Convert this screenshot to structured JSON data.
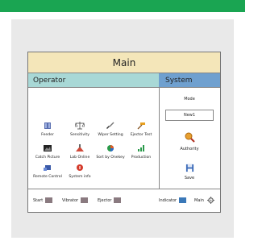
{
  "title": "Main",
  "sections": {
    "operator": "Operator",
    "system": "System"
  },
  "tools": [
    {
      "label": "Feeder",
      "icon": "feeder-icon"
    },
    {
      "label": "Sensitivity",
      "icon": "scale-icon"
    },
    {
      "label": "Wiper Setting",
      "icon": "brush-icon"
    },
    {
      "label": "Ejector Test",
      "icon": "hammer-icon"
    },
    {
      "label": "Catch Picture",
      "icon": "picture-icon"
    },
    {
      "label": "Lab Online",
      "icon": "flask-icon"
    },
    {
      "label": "Sort by Onekey",
      "icon": "sort-icon"
    },
    {
      "label": "Production",
      "icon": "chart-icon"
    },
    {
      "label": "Remote Control",
      "icon": "remote-icon"
    },
    {
      "label": "System info",
      "icon": "info-icon"
    }
  ],
  "system": {
    "mode_label": "Mode",
    "mode_value": "New1",
    "authority_label": "Authority",
    "save_label": "Save"
  },
  "footer": {
    "start": "Start",
    "vibrator": "Vibrator",
    "ejector": "Ejector",
    "indicator": "Indicator",
    "main": "Main"
  },
  "colors": {
    "top_bar": "#1aa552",
    "title_bg": "#f4e6b9",
    "operator_bg": "#a8d8d6",
    "system_bg": "#6fa0cf",
    "status_off": "#8a7a80",
    "indicator": "#3a78b8"
  }
}
